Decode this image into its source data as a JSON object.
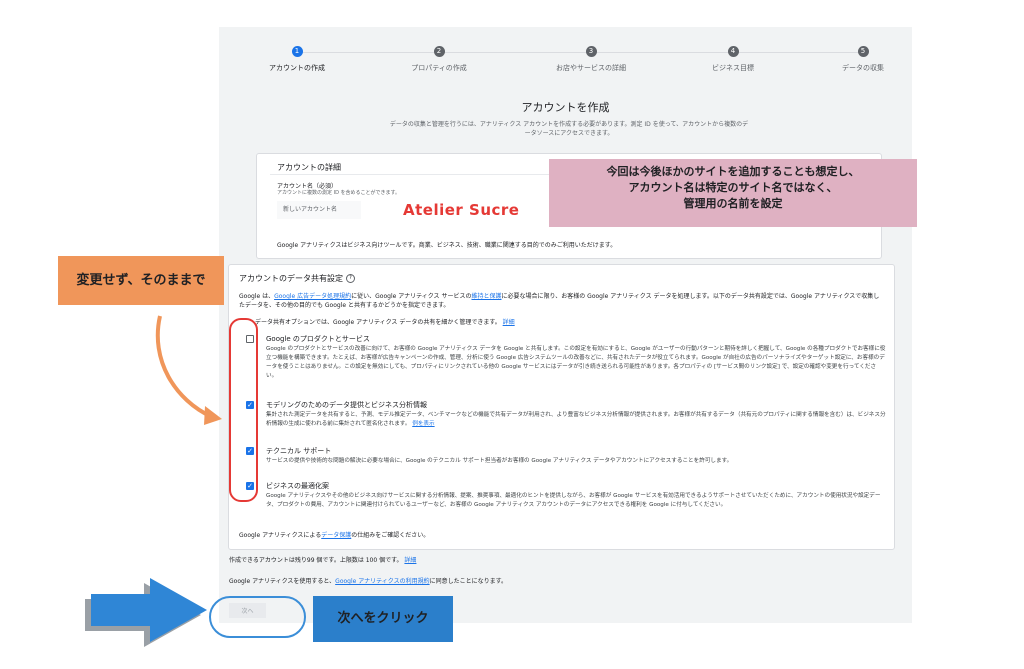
{
  "stepper": {
    "steps": [
      {
        "num": "1",
        "label": "アカウントの作成"
      },
      {
        "num": "2",
        "label": "プロパティの作成"
      },
      {
        "num": "3",
        "label": "お店やサービスの詳細"
      },
      {
        "num": "4",
        "label": "ビジネス目標"
      },
      {
        "num": "5",
        "label": "データの収集"
      }
    ]
  },
  "page": {
    "title": "アカウントを作成",
    "subtitle": "データの収集と管理を行うには、アナリティクス アカウントを作成する必要があります。測定 ID を使って、アカウントから複数のデータソースにアクセスできます。"
  },
  "details": {
    "heading": "アカウントの詳細",
    "field_label": "アカウント名（必須）",
    "field_hint": "アカウントに複数の測定 ID を含めることができます。",
    "field_placeholder": "新しいアカウント名",
    "field_value": "Atelier Sucre",
    "note": "Google アナリティクスはビジネス向けツールです。商業、ビジネス、技術、職業に関連する目的でのみご利用いただけます。"
  },
  "sharing": {
    "heading": "アカウントのデータ共有設定",
    "help_icon": "?",
    "intro_pre": "Google は、",
    "intro_link1": "Google 広告データ処理規約",
    "intro_mid": "に従い、Google アナリティクス サービスの",
    "intro_link2": "維持と保護",
    "intro_post": "に必要な場合に限り、お客様の Google アナリティクス データを処理します。以下のデータ共有設定では、Google アナリティクスで収集したデータを、その他の目的でも Google と共有するかどうかを指定できます。",
    "intro2": "データ共有オプションでは、Google アナリティクス データの共有を細かく管理できます。",
    "intro2_link": "詳細",
    "options": [
      {
        "title": "Google のプロダクトとサービス",
        "checked": false,
        "desc": "Google のプロダクトとサービスの改善に向けて、お客様の Google アナリティクス データを Google と共有します。この設定を有効にすると、Google がユーザーの行動パターンと期待を詳しく把握して、Google の各種プロダクトでお客様に役立つ機能を構築できます。たとえば、お客様が広告キャンペーンの作成、管理、分析に使う Google 広告システムツールの改善などに、共有されたデータが役立てられます。Google が自社の広告のパーソナライズやターゲット設定に、お客様のデータを使うことはありません。この設定を無効にしても、プロパティにリンクされている他の Google サービスにはデータが引き続き送られる可能性があります。各プロパティの [サービス間のリンク設定] で、設定の確認や変更を行ってください。"
      },
      {
        "title": "モデリングのためのデータ提供とビジネス分析情報",
        "checked": true,
        "desc": "集計された測定データを共有すると、予測、モデル推定データ、ベンチマークなどの機能で共有データが利用され、より豊富なビジネス分析情報が提供されます。お客様が共有するデータ（共有元のプロパティに関する情報を含む）は、ビジネス分析情報の生成に使われる前に集計されて匿名化されます。",
        "link": "例を表示"
      },
      {
        "title": "テクニカル サポート",
        "checked": true,
        "desc": "サービスの提供や技術的な問題の解決に必要な場合に、Google のテクニカル サポート担当者がお客様の Google アナリティクス データやアカウントにアクセスすることを許可します。"
      },
      {
        "title": "ビジネスの最適化案",
        "checked": true,
        "desc": "Google アナリティクスやその他のビジネス向けサービスに関する分析情報、提案、推奨事項、最適化のヒントを提供しながら、お客様が Google サービスを有効活用できるようサポートさせていただくために、アカウントの使用状況や設定データ、プロダクトの費用、アカウントに関連付けられているユーザーなど、お客様の Google アナリティクス アカウントのデータにアクセスできる権利を Google に付与してください。"
      }
    ],
    "footer_pre": "Google アナリティクスによる",
    "footer_link": "データ保護",
    "footer_post": "の仕組みをご確認ください。"
  },
  "bottom": {
    "accounts_text": "作成できるアカウントは残り99 個です。上限数は 100 個です。",
    "accounts_link": "詳細",
    "terms_pre": "Google アナリティクスを使用すると、",
    "terms_link": "Google アナリティクスの利用規約",
    "terms_post": "に同意したことになります。",
    "next_button": "次へ"
  },
  "annotations": {
    "pink_line1": "今回は今後ほかのサイトを追加することも想定し、",
    "pink_line2": "アカウント名は特定のサイト名ではなく、",
    "pink_line3": "管理用の名前を設定",
    "orange_label": "変更せず、そのままで",
    "blue_label": "次へをクリック",
    "colors": {
      "orange": "#f0965a",
      "pink": "#dfb1c2",
      "blue": "#2b7fcb",
      "red": "#e53935",
      "arrow_blue": "#2f86d6"
    }
  }
}
